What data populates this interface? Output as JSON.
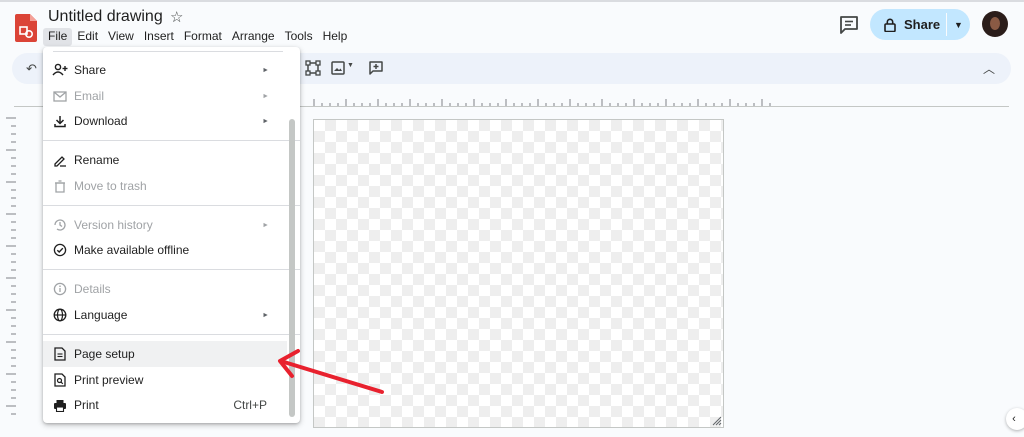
{
  "app": {
    "title": "Untitled drawing",
    "colors": {
      "accent": "#c2e7ff",
      "logo": "#db4437",
      "annotation": "#e8212e"
    }
  },
  "menubar": {
    "items": [
      {
        "label": "File"
      },
      {
        "label": "Edit"
      },
      {
        "label": "View"
      },
      {
        "label": "Insert"
      },
      {
        "label": "Format"
      },
      {
        "label": "Arrange"
      },
      {
        "label": "Tools"
      },
      {
        "label": "Help"
      }
    ]
  },
  "header": {
    "share_label": "Share"
  },
  "file_menu": {
    "share": {
      "label": "Share",
      "icon": "person-add-icon"
    },
    "email": {
      "label": "Email",
      "icon": "mail-icon"
    },
    "download": {
      "label": "Download",
      "icon": "download-icon"
    },
    "rename": {
      "label": "Rename",
      "icon": "rename-icon"
    },
    "trash": {
      "label": "Move to trash",
      "icon": "trash-icon"
    },
    "version": {
      "label": "Version history",
      "icon": "history-icon"
    },
    "offline": {
      "label": "Make available offline",
      "icon": "offline-check-icon"
    },
    "details": {
      "label": "Details",
      "icon": "info-icon"
    },
    "language": {
      "label": "Language",
      "icon": "globe-icon"
    },
    "page_setup": {
      "label": "Page setup",
      "icon": "page-icon"
    },
    "print_preview": {
      "label": "Print preview",
      "icon": "print-preview-icon"
    },
    "print": {
      "label": "Print",
      "icon": "printer-icon",
      "shortcut": "Ctrl+P"
    }
  }
}
